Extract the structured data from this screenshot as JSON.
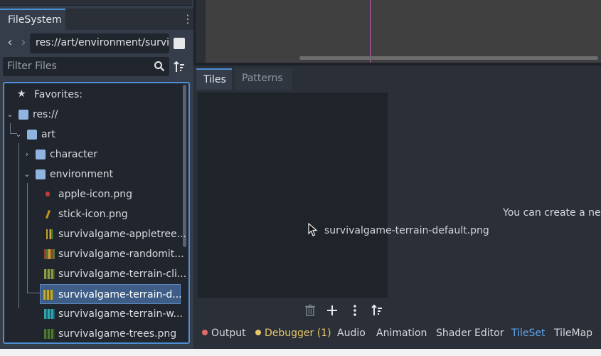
{
  "filesystem": {
    "tab_label": "FileSystem",
    "path": "res://art/environment/survi",
    "filter_placeholder": "Filter Files",
    "tree": {
      "favorites": "Favorites:",
      "root": "res://",
      "art": "art",
      "character": "character",
      "environment": "environment",
      "files": [
        "apple-icon.png",
        "stick-icon.png",
        "survivalgame-appletree...",
        "survivalgame-randomit...",
        "survivalgame-terrain-cli...",
        "survivalgame-terrain-d...",
        "survivalgame-terrain-w...",
        "survivalgame-trees.png"
      ],
      "selected_file": "survivalgame-terrain-d..."
    }
  },
  "tileset": {
    "tabs": [
      "Tiles",
      "Patterns"
    ],
    "active_tab": "Tiles",
    "drag_preview_label": "survivalgame-terrain-default.png",
    "hint": "You can create a new"
  },
  "bottom_panel": {
    "items": [
      "Output",
      "Debugger (1)",
      "Audio",
      "Animation",
      "Shader Editor",
      "TileSet",
      "TileMap"
    ],
    "active": "TileSet"
  },
  "colors": {
    "accent": "#4d8fd6",
    "output_dot": "#e06c6c",
    "debugger": "#e8c86a",
    "active_tab_text": "#5fa7ee"
  }
}
